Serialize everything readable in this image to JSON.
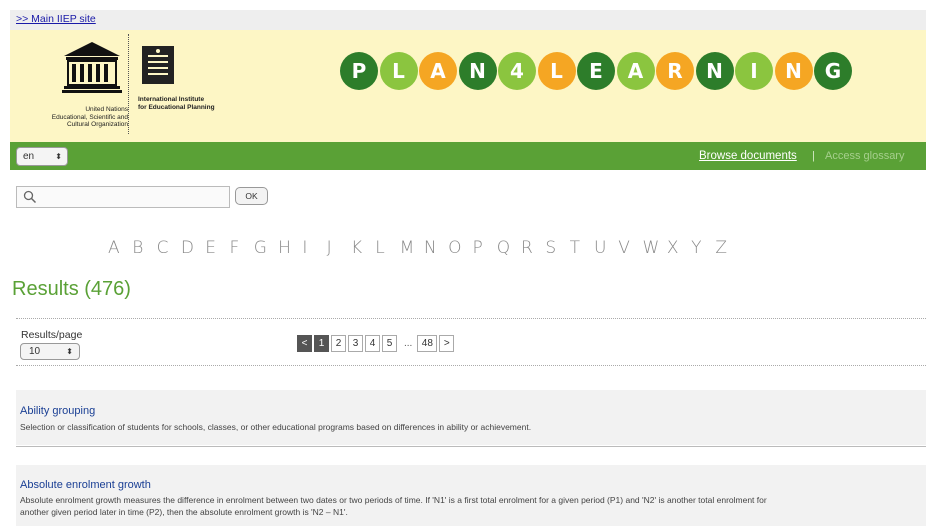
{
  "topbar": {
    "main_site_link": ">> Main IIEP site"
  },
  "banner": {
    "unesco_caption": "United Nations\nEducational, Scientific and\nCultural Organization",
    "iiep_caption": "International Institute\nfor Educational Planning",
    "plan4learning": [
      "P",
      "L",
      "A",
      "N",
      "4",
      "L",
      "E",
      "A",
      "R",
      "N",
      "I",
      "N",
      "G"
    ],
    "plan4learning_colors": [
      "#2d7d2a",
      "#8bc53f",
      "#f5a623",
      "#2d7d2a",
      "#8bc53f",
      "#f5a623",
      "#2d7d2a",
      "#8bc53f",
      "#f5a623",
      "#2d7d2a",
      "#8bc53f",
      "#f5a623",
      "#2d7d2a"
    ]
  },
  "navbar": {
    "language": "en",
    "browse_documents": "Browse documents",
    "separator": "|",
    "access_glossary": "Access glossary"
  },
  "search": {
    "value": "",
    "ok_label": "OK"
  },
  "alphabet": [
    "A",
    "B",
    "C",
    "D",
    "E",
    "F",
    "G",
    "H",
    "I",
    "J",
    "K",
    "L",
    "M",
    "N",
    "O",
    "P",
    "Q",
    "R",
    "S",
    "T",
    "U",
    "V",
    "W",
    "X",
    "Y",
    "Z"
  ],
  "results": {
    "title": "Results (476)",
    "per_page_label": "Results/page",
    "per_page_value": "10"
  },
  "pagination": {
    "prev": "<",
    "pages": [
      "1",
      "2",
      "3",
      "4",
      "5"
    ],
    "ellipsis": "...",
    "last": "48",
    "next": ">"
  },
  "entries": [
    {
      "title": "Ability grouping",
      "description": "Selection or classification of students for schools, classes, or other educational programs based on differences in ability or achievement."
    },
    {
      "title": "Absolute enrolment growth",
      "description": "Absolute enrolment growth measures the difference in enrolment between two dates or two periods of time. If 'N1' is a first total enrolment for a given period (P1) and 'N2' is another total enrolment for another given period later in time (P2), then the absolute enrolment growth is 'N2 – N1'."
    }
  ]
}
